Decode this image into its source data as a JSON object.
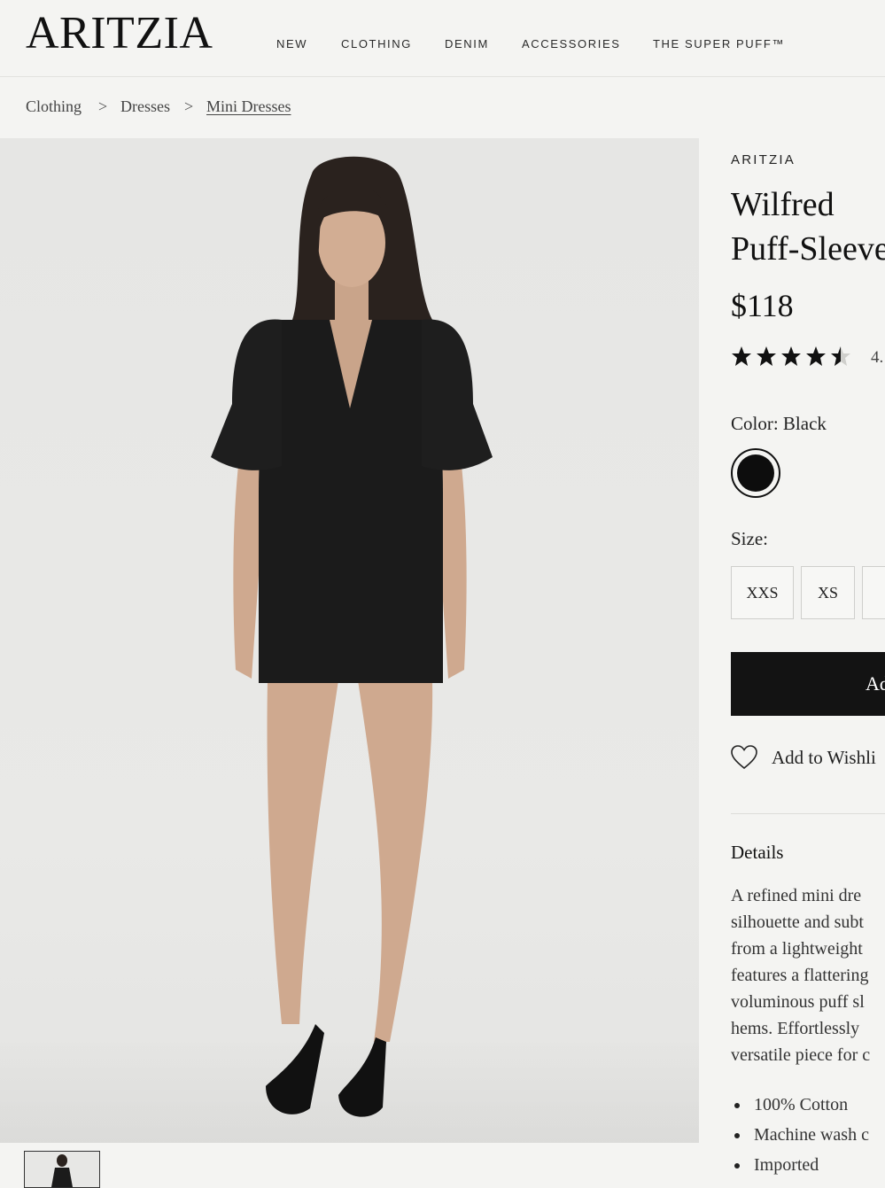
{
  "header": {
    "logo": "ARITZIA",
    "nav": [
      "NEW",
      "CLOTHING",
      "DENIM",
      "ACCESSORIES",
      "THE SUPER PUFF™"
    ]
  },
  "breadcrumb": {
    "items": [
      "Clothing",
      "Dresses",
      "Mini Dresses"
    ],
    "separator": ">"
  },
  "product": {
    "brand": "ARITZIA",
    "title_line1": "Wilfred",
    "title_line2": "Puff-Sleeve",
    "price": "$118",
    "rating_value": 4.5,
    "rating_text": "4.",
    "color_label": "Color: Black",
    "color_swatch": "#0d0d0d",
    "size_label": "Size:",
    "sizes": [
      "XXS",
      "XS",
      ""
    ],
    "add_to_bag": "Ad",
    "wishlist": "Add to Wishli",
    "details_heading": "Details",
    "description_lines": [
      "A refined mini dre",
      "silhouette and subt",
      "from a lightweight",
      "features a flattering",
      "voluminous puff sl",
      "hems. Effortlessly",
      "versatile piece for c"
    ],
    "bullets": [
      "100% Cotton",
      "Machine wash c",
      "Imported"
    ]
  },
  "colors": {
    "background": "#f4f4f2",
    "button": "#131313",
    "dress": "#1b1b1b"
  }
}
